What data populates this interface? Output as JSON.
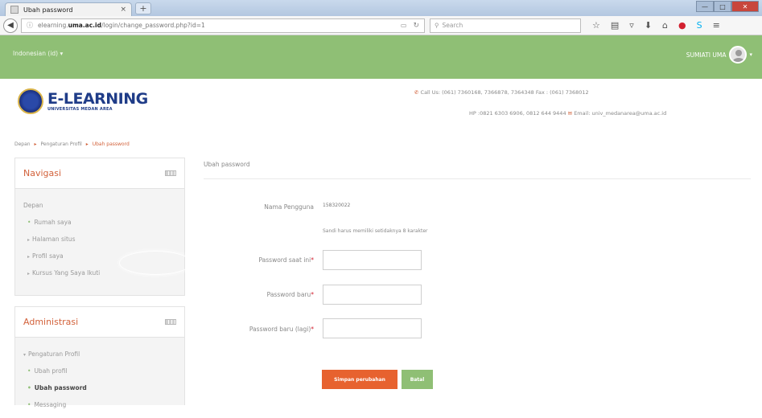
{
  "browser": {
    "tab_title": "Ubah password",
    "tab_close": "×",
    "new_tab": "+",
    "url_prefix": "elearning.",
    "url_domain": "uma.ac.id",
    "url_path": "/login/change_password.php?id=1",
    "search_placeholder": "Search",
    "window_min": "—",
    "window_max": "□",
    "window_close": "✕"
  },
  "topbar": {
    "language": "Indonesian (id) ▾",
    "user_name": "SUMIATI UMA"
  },
  "logo": {
    "title": "E-LEARNING",
    "subtitle": "UNIVERSITAS MEDAN AREA"
  },
  "contact": {
    "line1": "Call Us: (061) 7360168, 7366878, 7364348 Fax : (061) 7368012",
    "hp": "HP :0821 6303 6906, 0812 644 9444",
    "email": "Email: univ_medanarea@uma.ac.id"
  },
  "breadcrumb": {
    "home": "Depan",
    "profile_settings": "Pengaturan Profil",
    "current": "Ubah password",
    "separator": "▸"
  },
  "navigation": {
    "title": "Navigasi",
    "items": [
      "Depan",
      "Rumah saya",
      "Halaman situs",
      "Profil saya",
      "Kursus Yang Saya Ikuti"
    ]
  },
  "administration": {
    "title": "Administrasi",
    "group": "Pengaturan Profil",
    "items": [
      "Ubah profil",
      "Ubah password",
      "Messaging"
    ]
  },
  "form": {
    "page_title": "Ubah password",
    "username_label": "Nama Pengguna",
    "username_value": "158320022",
    "password_hint": "Sandi harus memiliki setidaknya 8 karakter",
    "current_password_label": "Password saat ini",
    "new_password_label": "Password baru",
    "new_password_again_label": "Password baru (lagi)",
    "required_mark": "*",
    "save_button": "Simpan perubahan",
    "cancel_button": "Batal"
  },
  "colors": {
    "accent_orange": "#e7622f",
    "header_green": "#8fbf75",
    "brand_blue": "#1f3c88"
  }
}
